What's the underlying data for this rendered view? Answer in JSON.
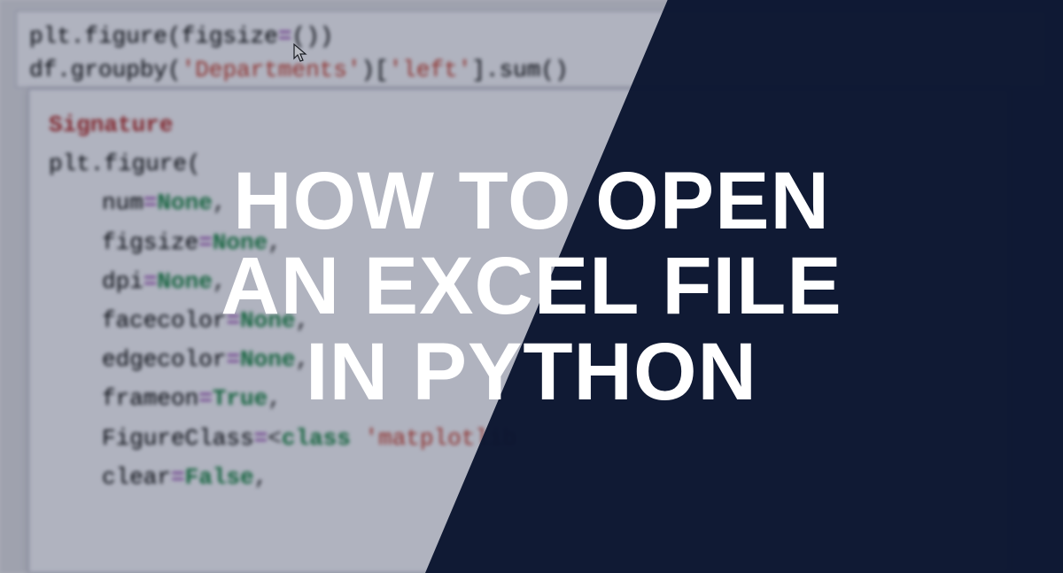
{
  "headline": {
    "line1": "HOW TO OPEN",
    "line2": "AN EXCEL FILE",
    "line3": "IN PYTHON"
  },
  "code": {
    "line1_pre": "plt.figure(figsize",
    "line1_eq": "=",
    "line1_post": "())",
    "line2_pre": "df.groupby(",
    "line2_str1": "'Departments'",
    "line2_mid": ")[",
    "line2_str2": "'left'",
    "line2_post": "].sum()"
  },
  "tooltip": {
    "sig_label": "Signature",
    "plt_label": "plt.figure(",
    "params": [
      {
        "name": "num",
        "eq": "=",
        "val": "None",
        "tail": ","
      },
      {
        "name": "figsize",
        "eq": "=",
        "val": "None",
        "tail": ","
      },
      {
        "name": "dpi",
        "eq": "=",
        "val": "None",
        "tail": ","
      },
      {
        "name": "facecolor",
        "eq": "=",
        "val": "None",
        "tail": ","
      },
      {
        "name": "edgecolor",
        "eq": "=",
        "val": "None",
        "tail": ","
      },
      {
        "name": "frameon",
        "eq": "=",
        "val": "True",
        "tail": ","
      },
      {
        "name": "FigureClass",
        "eq": "=",
        "val_pre": "<",
        "val_kw": "class ",
        "val_str": "'matplotlib",
        "tail": ""
      },
      {
        "name": "clear",
        "eq": "=",
        "val": "False",
        "tail": ","
      }
    ]
  }
}
